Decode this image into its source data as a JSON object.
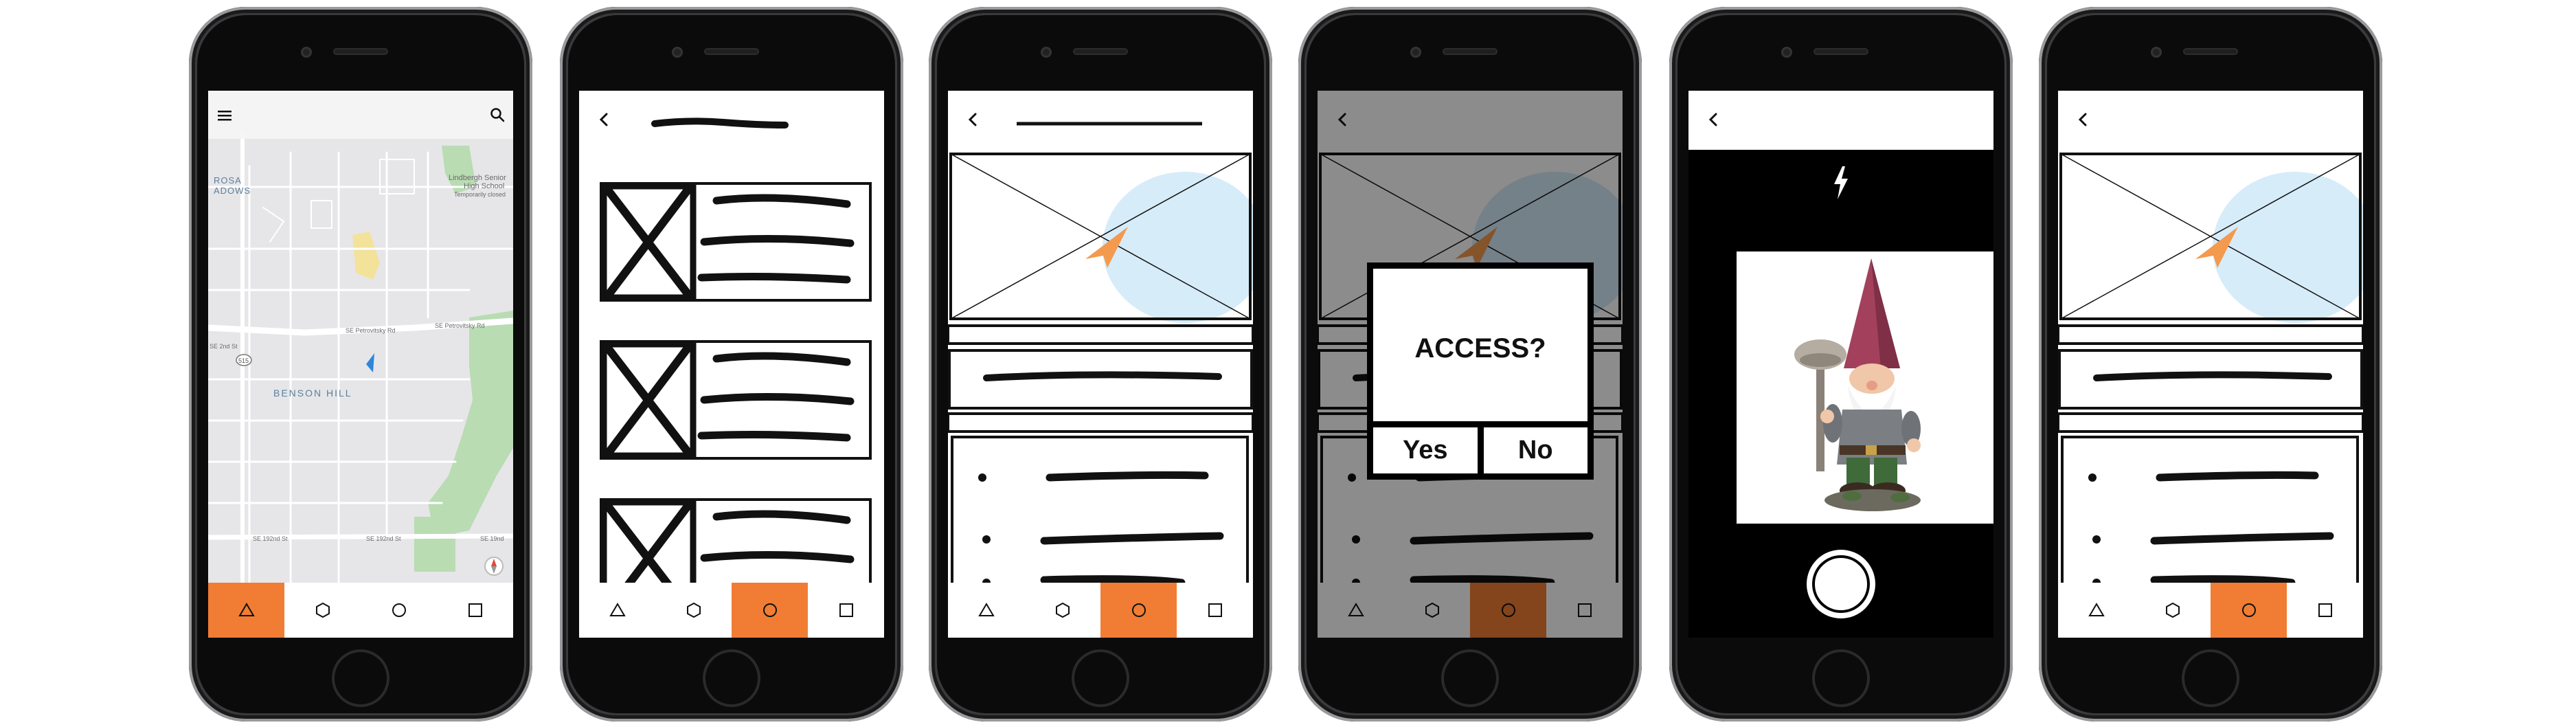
{
  "colors": {
    "accent": "#f07d33",
    "map_bg": "#e8e8ea",
    "park": "#b9dcb3",
    "highlight": "#f3e29a",
    "location_blue": "#2f86d9",
    "circle": "#d6ecf9"
  },
  "tabs": [
    {
      "icon": "triangle-icon"
    },
    {
      "icon": "hexagon-icon"
    },
    {
      "icon": "circle-icon"
    },
    {
      "icon": "square-icon"
    }
  ],
  "map": {
    "labels": {
      "rosa_1": "ROSA",
      "rosa_2": "ADOWS",
      "school_1": "Lindbergh Senior",
      "school_2": "High School",
      "school_3": "Temporarily closed",
      "street_petrovitsky_1": "SE Petrovitsky Rd",
      "street_petrovitsky_2": "SE Petrovitsky Rd",
      "street_left": "SE 2nd St",
      "route_number": "515",
      "neighborhood": "BENSON HILL",
      "street_192nd_1": "SE 192nd St",
      "street_192nd_2": "SE 192nd St",
      "street_right": "SE 19nd"
    }
  },
  "dialog": {
    "title": "ACCESS?",
    "yes": "Yes",
    "no": "No"
  },
  "camera": {
    "flash_icon": "lightning-icon",
    "shutter_icon": "shutter-button",
    "photo_subject": "garden gnome"
  }
}
